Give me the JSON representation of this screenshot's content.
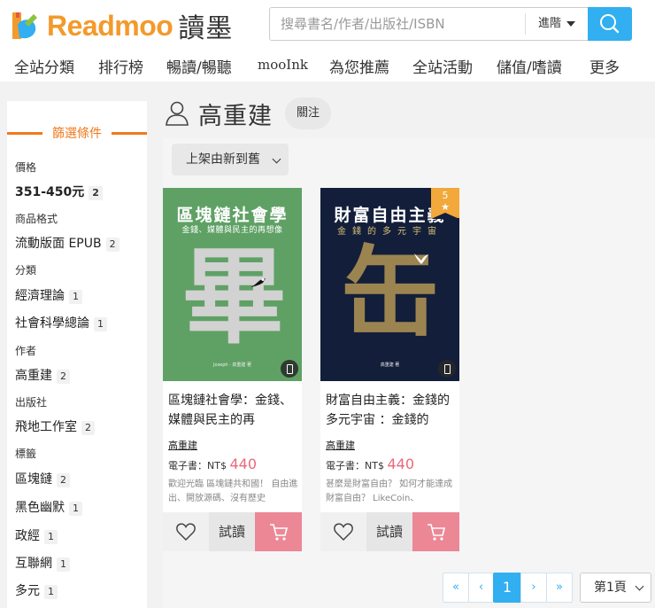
{
  "brand": {
    "name_en": "Readmoo",
    "name_cn": "讀墨",
    "colors": {
      "orange": "#f39a2b",
      "blue": "#31aff0",
      "pink": "#ec8796"
    }
  },
  "search": {
    "placeholder": "搜尋書名/作者/出版社/ISBN",
    "advanced_label": "進階"
  },
  "nav": [
    "全站分類",
    "排行榜",
    "暢讀/暢聽",
    "mooInk",
    "為您推薦",
    "全站活動",
    "儲值/嗜讀",
    "更多"
  ],
  "sidebar": {
    "title": "篩選條件",
    "sections": [
      {
        "label": "價格",
        "items": [
          {
            "label": "351-450元",
            "count": "2"
          }
        ]
      },
      {
        "label": "商品格式",
        "items": [
          {
            "label": "流動版面 EPUB",
            "count": "2"
          }
        ]
      },
      {
        "label": "分類",
        "items": [
          {
            "label": "經濟理論",
            "count": "1"
          },
          {
            "label": "社會科學總論",
            "count": "1"
          }
        ]
      },
      {
        "label": "作者",
        "items": [
          {
            "label": "高重建",
            "count": "2"
          }
        ]
      },
      {
        "label": "出版社",
        "items": [
          {
            "label": "飛地工作室",
            "count": "2"
          }
        ]
      },
      {
        "label": "標籤",
        "items": [
          {
            "label": "區塊鏈",
            "count": "2"
          },
          {
            "label": "黑色幽默",
            "count": "1"
          },
          {
            "label": "政經",
            "count": "1"
          },
          {
            "label": "互聯網",
            "count": "1"
          },
          {
            "label": "多元",
            "count": "1"
          }
        ]
      }
    ]
  },
  "author": {
    "name": "高重建",
    "follow_label": "關注"
  },
  "sort": {
    "selected": "上架由新到舊"
  },
  "books": [
    {
      "cover_title": "區塊鏈社會學",
      "cover_subtitle": "金錢、媒體與民主的再想像",
      "cover_glyph": "畢",
      "cover_author": "Joseph · 高重建 著",
      "cover_color": "#5fa165",
      "title": "區塊鏈社會學：金錢、媒體與民主的再",
      "author": "高重建",
      "price_label": "電子書：",
      "currency": "NT$",
      "price": "440",
      "desc": "歡迎光臨 區塊鏈共和國！ 自由進出、開放源碼、沒有歷史",
      "trial_label": "試讀"
    },
    {
      "cover_title": "財富自由主義",
      "cover_subtitle": "金錢的多元宇宙",
      "cover_glyph": "缶",
      "cover_author": "高重建 著",
      "cover_color": "#131e3a",
      "badge_number": "5",
      "badge_star": "★",
      "title": "財富自由主義：金錢的多元宇宙 ：金錢的",
      "author": "高重建",
      "price_label": "電子書：",
      "currency": "NT$",
      "price": "440",
      "desc": "甚麼是財富自由？ 如何才能達成財富自由？ LikeCoin、",
      "trial_label": "試讀"
    }
  ],
  "pagination": {
    "first": "«",
    "prev": "‹",
    "current": "1",
    "next": "›",
    "last": "»",
    "page_select": "第1頁"
  }
}
